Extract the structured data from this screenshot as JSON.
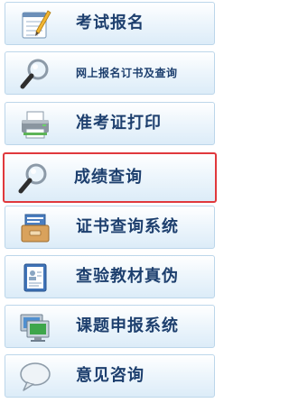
{
  "menu": {
    "items": [
      {
        "label": "考试报名",
        "icon": "notepad-pencil-icon"
      },
      {
        "label": "网上报名订书及查询",
        "icon": "magnifier-icon"
      },
      {
        "label": "准考证打印",
        "icon": "printer-icon"
      },
      {
        "label": "成绩查询",
        "icon": "magnifier-icon",
        "highlighted": true
      },
      {
        "label": "证书查询系统",
        "icon": "card-drawer-icon"
      },
      {
        "label": "查验教材真伪",
        "icon": "id-book-icon"
      },
      {
        "label": "课题申报系统",
        "icon": "monitor-icon"
      },
      {
        "label": "意见咨询",
        "icon": "speech-bubble-icon"
      }
    ]
  },
  "colors": {
    "label_text": "#1d3f6e",
    "item_border": "#bcd6ea",
    "highlight_border": "#e0383c"
  }
}
